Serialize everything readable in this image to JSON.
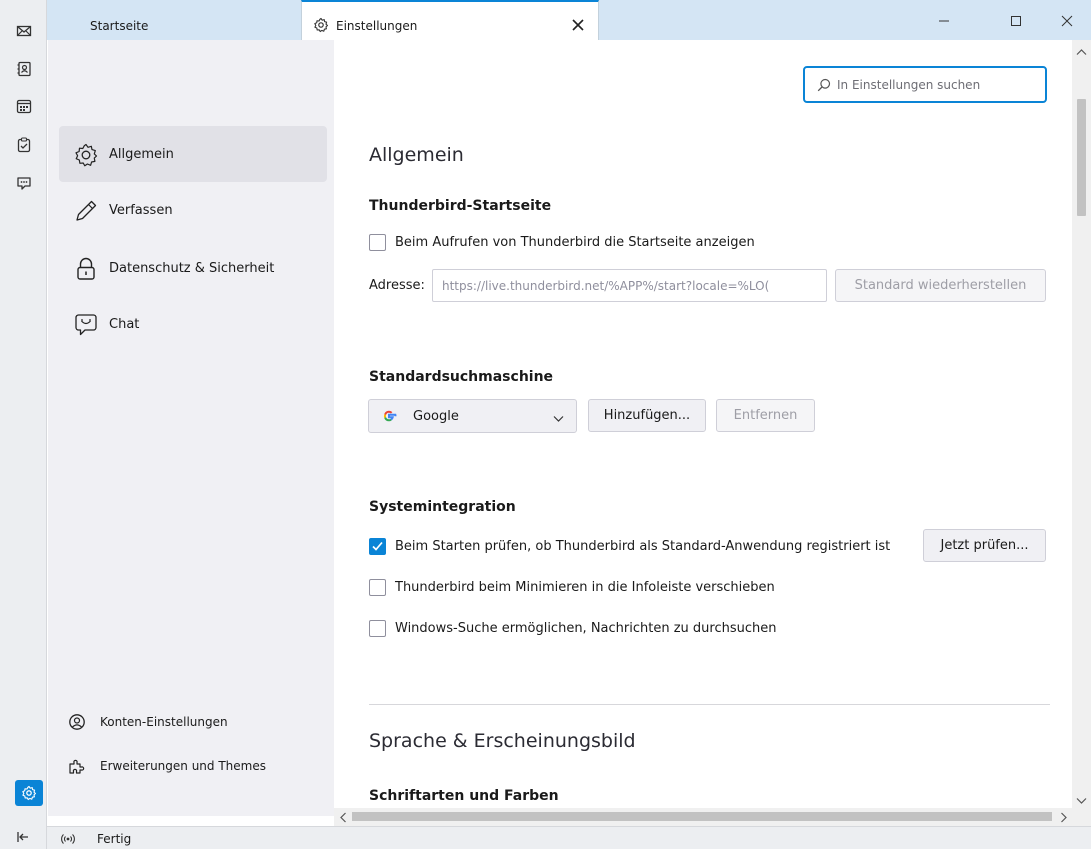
{
  "tabs": [
    {
      "label": "Startseite",
      "active": false
    },
    {
      "label": "Einstellungen",
      "active": true
    }
  ],
  "window_controls": [
    "minimize-icon",
    "maximize-icon",
    "close-icon"
  ],
  "spaces": [
    "mail-icon",
    "address-book-icon",
    "calendar-icon",
    "tasks-icon",
    "chat-icon",
    "settings-icon",
    "collapse-icon"
  ],
  "categories": [
    {
      "label": "Allgemein",
      "icon": "gear-icon",
      "selected": true
    },
    {
      "label": "Verfassen",
      "icon": "pencil-icon",
      "selected": false
    },
    {
      "label": "Datenschutz & Sicherheit",
      "icon": "lock-icon",
      "selected": false
    },
    {
      "label": "Chat",
      "icon": "chat-icon",
      "selected": false
    }
  ],
  "footer_links": [
    {
      "label": "Konten-Einstellungen",
      "icon": "account-icon"
    },
    {
      "label": "Erweiterungen und Themes",
      "icon": "puzzle-icon"
    }
  ],
  "search": {
    "placeholder": "In Einstellungen suchen"
  },
  "main": {
    "heading": "Allgemein",
    "startpage": {
      "title": "Thunderbird-Startseite",
      "checkbox_label": "Beim Aufrufen von Thunderbird die Startseite anzeigen",
      "checked": false,
      "address_label": "Adresse:",
      "address_value": "https://live.thunderbird.net/%APP%/start?locale=%LO(",
      "restore_button": "Standard wiederherstellen"
    },
    "search_engine": {
      "title": "Standardsuchmaschine",
      "selected": "Google",
      "add_button": "Hinzufügen...",
      "remove_button": "Entfernen"
    },
    "system": {
      "title": "Systemintegration",
      "check_default_label": "Beim Starten prüfen, ob Thunderbird als Standard-Anwendung registriert ist",
      "check_default_checked": true,
      "check_now_button": "Jetzt prüfen...",
      "minimize_label": "Thunderbird beim Minimieren in die Infoleiste verschieben",
      "minimize_checked": false,
      "search_label": "Windows-Suche ermöglichen, Nachrichten zu durchsuchen",
      "search_checked": false
    },
    "language_heading": "Sprache & Erscheinungsbild",
    "fonts_title": "Schriftarten und Farben"
  },
  "status": {
    "text": "Fertig"
  },
  "colors": {
    "accent": "#0a84d6",
    "tabstrip": "#d4e5f4",
    "sidebar": "#f0f0f4"
  }
}
